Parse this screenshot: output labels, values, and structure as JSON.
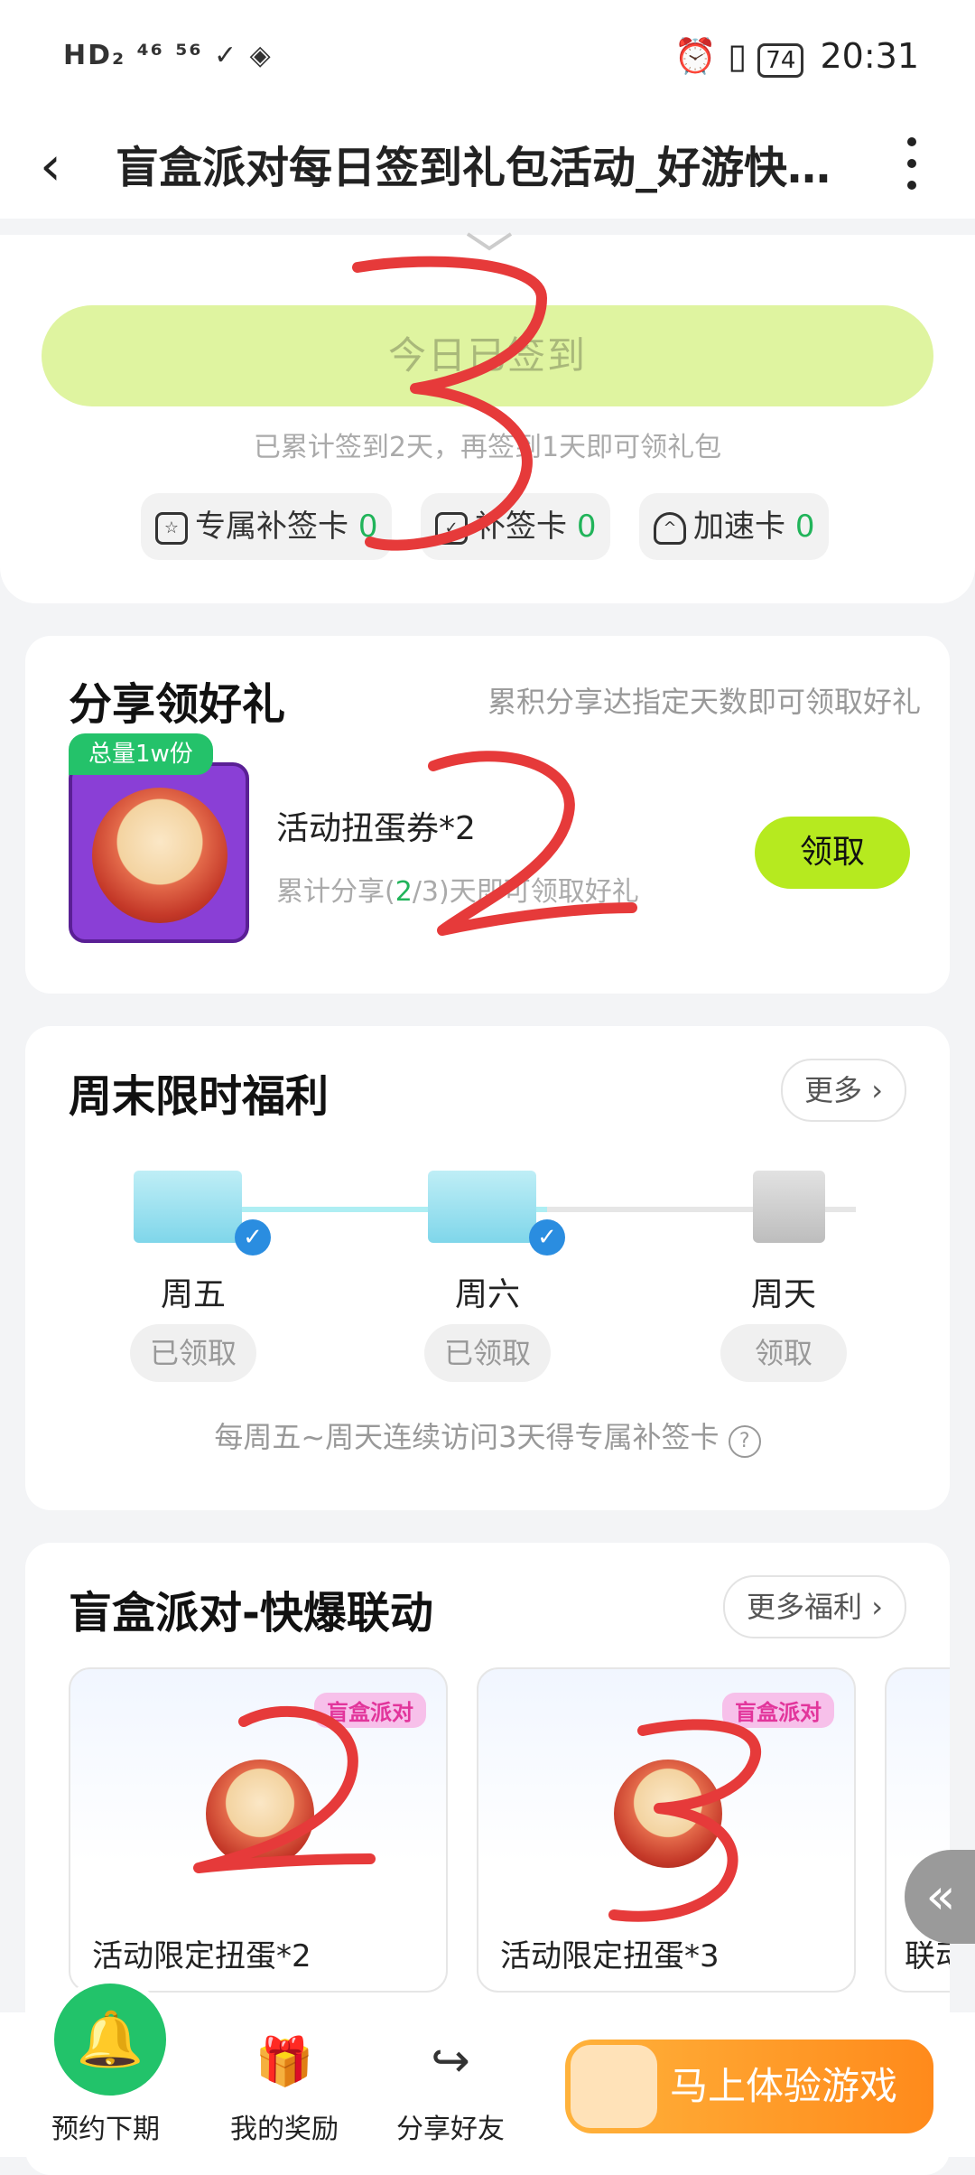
{
  "status_bar": {
    "left": "HD₂ ⁴⁶ ⁵⁶ ✓ ◈",
    "battery": "74",
    "time": "20:31"
  },
  "header": {
    "title": "盲盒派对每日签到礼包活动_好游快…"
  },
  "signin": {
    "button": "今日已签到",
    "note": "已累计签到2天，再签到1天即可领礼包",
    "chips": [
      {
        "label": "专属补签卡",
        "count": "0"
      },
      {
        "label": "补签卡",
        "count": "0"
      },
      {
        "label": "加速卡",
        "count": "0"
      }
    ]
  },
  "share": {
    "title": "分享领好礼",
    "subtitle": "累积分享达指定天数即可领取好礼",
    "tag": "总量1w份",
    "item_name": "活动扭蛋券*2",
    "progress_prefix": "累计分享(",
    "progress_done": "2",
    "progress_suffix": "/3)天即可领取好礼",
    "claim": "领取"
  },
  "weekend": {
    "title": "周末限时福利",
    "more": "更多",
    "days": [
      {
        "label": "周五",
        "status": "已领取"
      },
      {
        "label": "周六",
        "status": "已领取"
      },
      {
        "label": "周天",
        "status": "领取"
      }
    ],
    "note": "每周五~周天连续访问3天得专属补签卡"
  },
  "collab": {
    "title": "盲盒派对-快爆联动",
    "more": "更多福利",
    "items": [
      {
        "label": "活动限定扭蛋*2",
        "brand": "盲盒派对"
      },
      {
        "label": "活动限定扭蛋*3",
        "brand": "盲盒派对"
      },
      {
        "label": "联动"
      }
    ]
  },
  "bottom": {
    "remind": "预约下期",
    "rewards": "我的奖励",
    "share": "分享好友",
    "play": "马上体验游戏"
  },
  "colors": {
    "accent_green": "#b6ea1f",
    "brand_green": "#22c36a",
    "annotation_red": "#e63a3a"
  }
}
